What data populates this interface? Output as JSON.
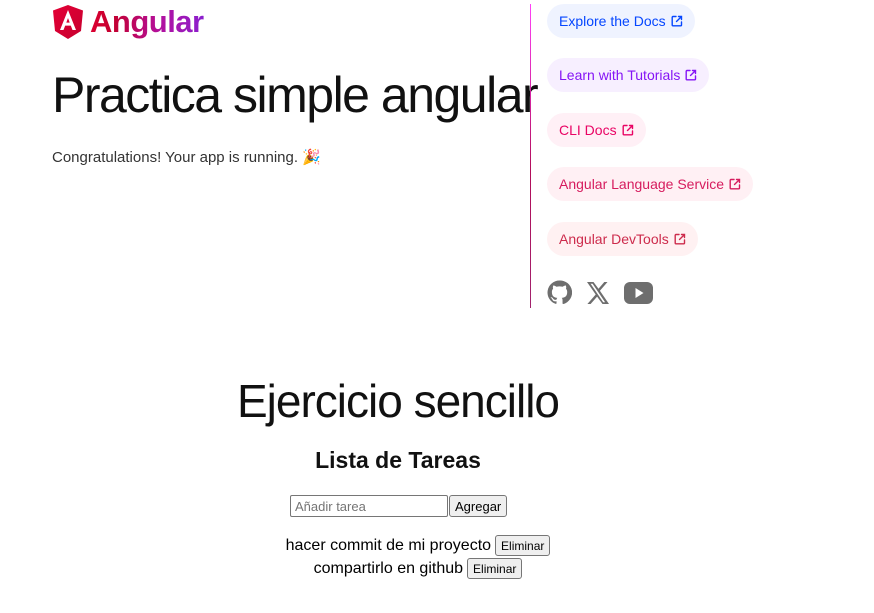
{
  "header": {
    "brand": "Angular",
    "title": "Practica simple angular",
    "subtitle": "Congratulations! Your app is running. 🎉"
  },
  "links": [
    {
      "label": "Explore the Docs",
      "icon": "external-link-icon"
    },
    {
      "label": "Learn with Tutorials",
      "icon": "external-link-icon"
    },
    {
      "label": "CLI Docs",
      "icon": "external-link-icon"
    },
    {
      "label": "Angular Language Service",
      "icon": "external-link-icon"
    },
    {
      "label": "Angular DevTools",
      "icon": "external-link-icon"
    }
  ],
  "social": [
    "github-icon",
    "x-icon",
    "youtube-icon"
  ],
  "exercise": {
    "title": "Ejercicio sencillo",
    "list_title": "Lista de Tareas",
    "input_value": "",
    "input_placeholder": "Añadir tarea",
    "add_label": "Agregar",
    "tasks": [
      {
        "text": "hacer commit de mi proyecto",
        "delete_label": "Eliminar"
      },
      {
        "text": "compartirlo en github",
        "delete_label": "Eliminar"
      }
    ]
  },
  "colors": {
    "brand_gradient_start": "#dd0031",
    "brand_gradient_end": "#8a1fcf",
    "link_blue": "#0546ff",
    "link_purple": "#8514f5",
    "link_pink": "#e90464",
    "social_gray": "#6e6e6e"
  }
}
